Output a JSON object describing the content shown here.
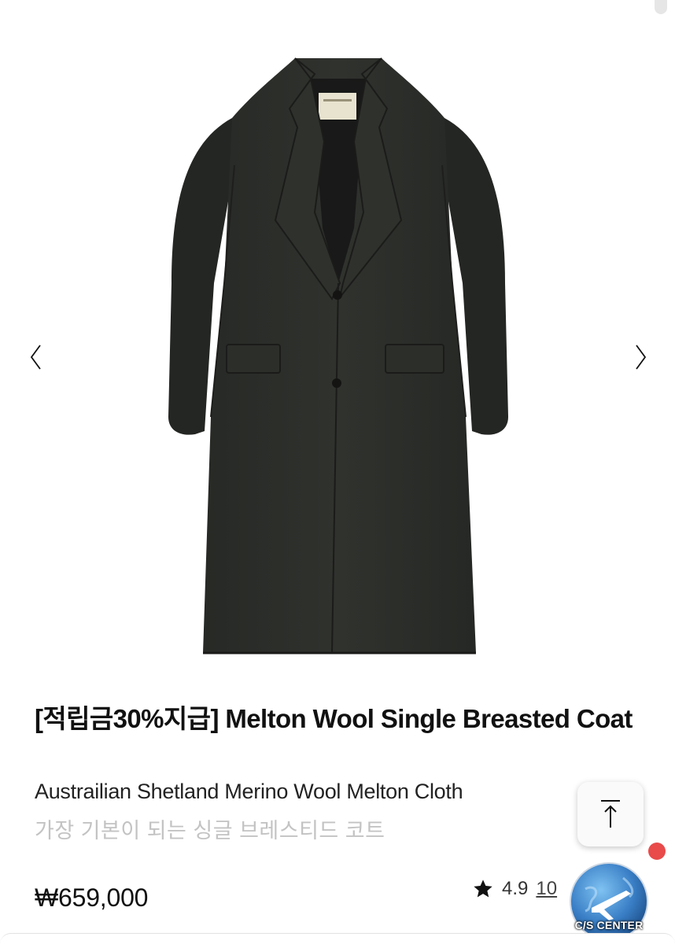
{
  "product": {
    "title": "[적립금30%지급] Melton Wool Single Breasted Coat",
    "subtitle": "Austrailian Shetland Merino Wool Melton Cloth",
    "korean_description": "가장 기본이 되는 싱글 브레스티드 코트",
    "price": "₩659,000",
    "rating": "4.9",
    "review_count": "10",
    "image_icon": "coat-photo"
  },
  "gallery": {
    "prev_icon": "chevron-left-icon",
    "next_icon": "chevron-right-icon"
  },
  "floating": {
    "scroll_top_icon": "arrow-up-to-top-icon",
    "cs_label": "C/S CENTER",
    "notification_color": "#e94a4a"
  },
  "colors": {
    "coat": "#2b2d2a",
    "muted_text": "#c3c3c3",
    "badge_blue": "#3a7fc6"
  }
}
